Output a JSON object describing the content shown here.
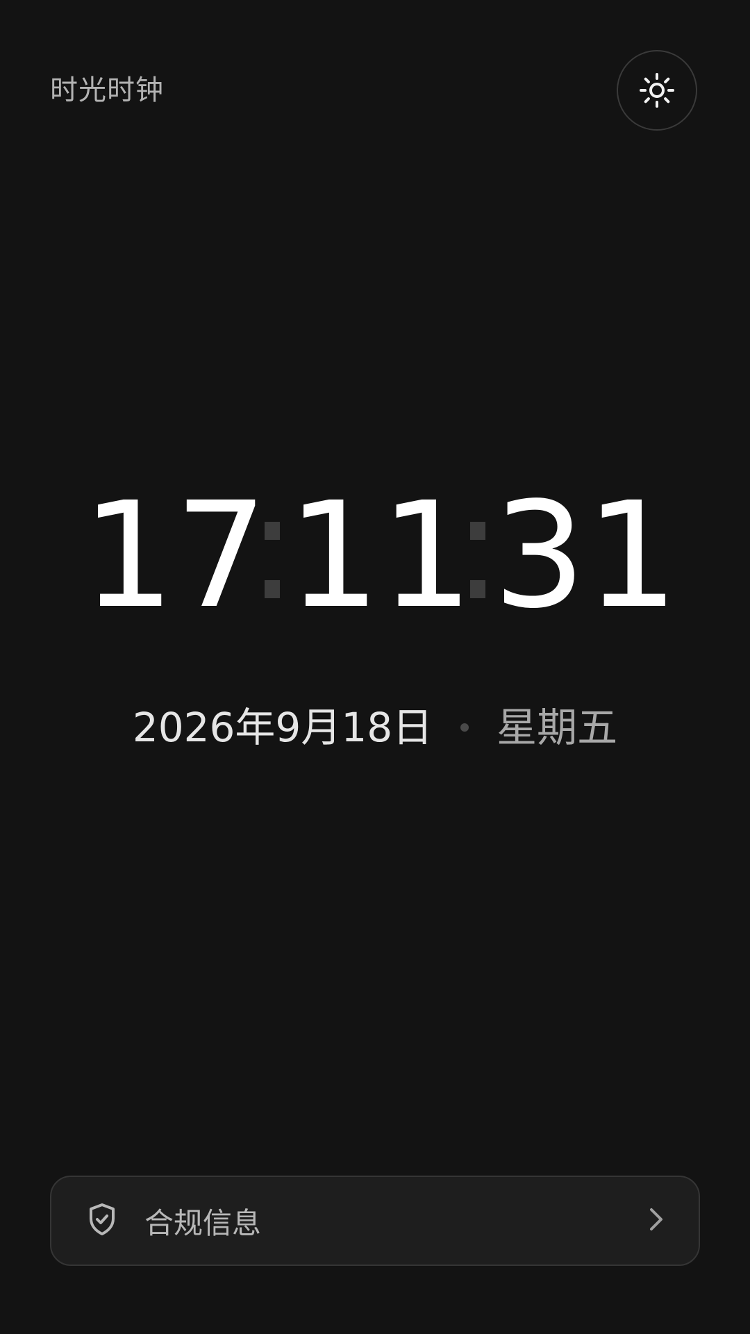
{
  "header": {
    "app_title": "时光时钟",
    "theme_toggle_icon": "sun-icon"
  },
  "clock": {
    "hours": "17",
    "minutes": "11",
    "seconds": "31"
  },
  "date": {
    "date_text": "2026年9月18日",
    "weekday": "星期五"
  },
  "footer": {
    "compliance_label": "合规信息",
    "compliance_icon": "shield-check-icon",
    "chevron_icon": "chevron-right-icon"
  },
  "colors": {
    "background": "#131313",
    "primary_text": "#ffffff",
    "muted_text": "#b3b3b3",
    "separator": "#3d3d3d",
    "card_background": "#1e1e1e",
    "card_border": "#353535"
  }
}
